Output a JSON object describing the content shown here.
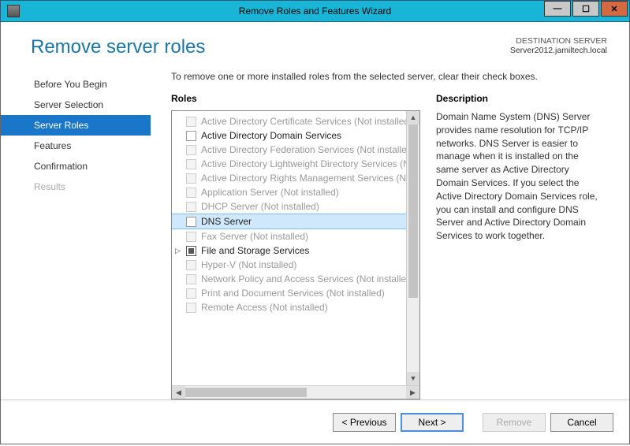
{
  "titlebar": {
    "title": "Remove Roles and Features Wizard"
  },
  "header": {
    "page_title": "Remove server roles",
    "destination_label": "DESTINATION SERVER",
    "destination_server": "Server2012.jamiltech.local"
  },
  "sidebar": {
    "items": [
      {
        "label": "Before You Begin",
        "state": "normal"
      },
      {
        "label": "Server Selection",
        "state": "normal"
      },
      {
        "label": "Server Roles",
        "state": "selected"
      },
      {
        "label": "Features",
        "state": "normal"
      },
      {
        "label": "Confirmation",
        "state": "normal"
      },
      {
        "label": "Results",
        "state": "disabled"
      }
    ]
  },
  "content": {
    "instruction": "To remove one or more installed roles from the selected server, clear their check boxes.",
    "roles_label": "Roles",
    "desc_label": "Description",
    "description": "Domain Name System (DNS) Server provides name resolution for TCP/IP networks. DNS Server is easier to manage when it is installed on the same server as Active Directory Domain Services. If you select the Active Directory Domain Services role, you can install and configure DNS Server and Active Directory Domain Services to work together.",
    "roles": [
      {
        "label": "Active Directory Certificate Services (Not installed)",
        "enabled": false,
        "checked": false
      },
      {
        "label": "Active Directory Domain Services",
        "enabled": true,
        "checked": false
      },
      {
        "label": "Active Directory Federation Services (Not installed)",
        "enabled": false,
        "checked": false
      },
      {
        "label": "Active Directory Lightweight Directory Services (Not installed)",
        "enabled": false,
        "checked": false
      },
      {
        "label": "Active Directory Rights Management Services (Not installed)",
        "enabled": false,
        "checked": false
      },
      {
        "label": "Application Server (Not installed)",
        "enabled": false,
        "checked": false
      },
      {
        "label": "DHCP Server (Not installed)",
        "enabled": false,
        "checked": false
      },
      {
        "label": "DNS Server",
        "enabled": true,
        "checked": false,
        "selected": true
      },
      {
        "label": "Fax Server (Not installed)",
        "enabled": false,
        "checked": false
      },
      {
        "label": "File and Storage Services",
        "enabled": true,
        "checked": "filled",
        "expandable": true
      },
      {
        "label": "Hyper-V (Not installed)",
        "enabled": false,
        "checked": false
      },
      {
        "label": "Network Policy and Access Services (Not installed)",
        "enabled": false,
        "checked": false
      },
      {
        "label": "Print and Document Services (Not installed)",
        "enabled": false,
        "checked": false
      },
      {
        "label": "Remote Access (Not installed)",
        "enabled": false,
        "checked": false
      }
    ]
  },
  "footer": {
    "previous": "<  Previous",
    "next": "Next  >",
    "remove": "Remove",
    "cancel": "Cancel"
  }
}
